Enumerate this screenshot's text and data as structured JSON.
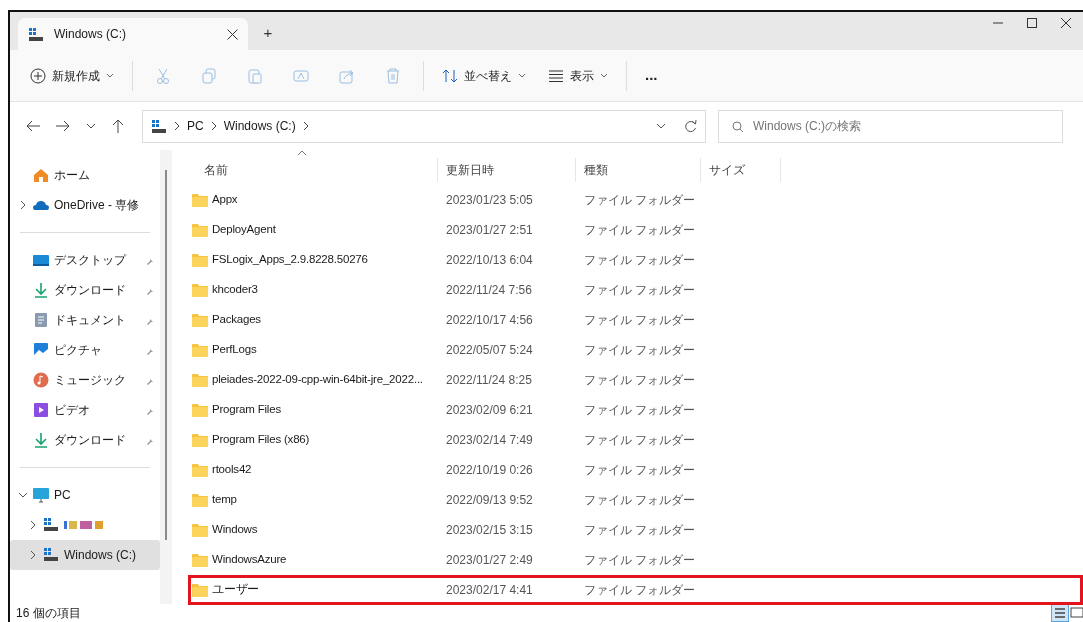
{
  "window": {
    "tab_title": "Windows (C:)",
    "new_tab": "+"
  },
  "toolbar": {
    "new": "新規作成",
    "sort": "並べ替え",
    "view": "表示",
    "more": "..."
  },
  "address": {
    "segments": [
      "PC",
      "Windows (C:)"
    ]
  },
  "search": {
    "placeholder": "Windows (C:)の検索"
  },
  "sidebar": {
    "items": [
      {
        "kind": "home",
        "label": "ホーム",
        "pinned": false,
        "expandable": false,
        "selected": false
      },
      {
        "kind": "cloud",
        "label": "OneDrive - 専修",
        "pinned": false,
        "expandable": true,
        "expanded": false,
        "selected": false
      },
      {
        "kind": "divider"
      },
      {
        "kind": "desktop",
        "label": "デスクトップ",
        "pinned": true,
        "expandable": false,
        "selected": false
      },
      {
        "kind": "download",
        "label": "ダウンロード",
        "pinned": true,
        "expandable": false,
        "selected": false
      },
      {
        "kind": "document",
        "label": "ドキュメント",
        "pinned": true,
        "expandable": false,
        "selected": false
      },
      {
        "kind": "picture",
        "label": "ピクチャ",
        "pinned": true,
        "expandable": false,
        "selected": false
      },
      {
        "kind": "music",
        "label": "ミュージック",
        "pinned": true,
        "expandable": false,
        "selected": false
      },
      {
        "kind": "video",
        "label": "ビデオ",
        "pinned": true,
        "expandable": false,
        "selected": false
      },
      {
        "kind": "download",
        "label": "ダウンロード",
        "pinned": true,
        "expandable": false,
        "selected": false
      },
      {
        "kind": "divider"
      },
      {
        "kind": "pc",
        "label": "PC",
        "pinned": false,
        "expandable": true,
        "expanded": true,
        "selected": false
      },
      {
        "kind": "drive",
        "pinned": false,
        "expandable": true,
        "expanded": false,
        "selected": false,
        "child": true
      },
      {
        "kind": "drive",
        "label": "Windows (C:)",
        "pinned": false,
        "expandable": true,
        "expanded": false,
        "selected": true,
        "child": true
      }
    ]
  },
  "table": {
    "columns": [
      "名前",
      "更新日時",
      "種類",
      "サイズ"
    ],
    "rows": [
      {
        "name": "Appx",
        "modified": "2023/01/23 5:05",
        "type": "ファイル フォルダー",
        "highlighted": false
      },
      {
        "name": "DeployAgent",
        "modified": "2023/01/27 2:51",
        "type": "ファイル フォルダー",
        "highlighted": false
      },
      {
        "name": "FSLogix_Apps_2.9.8228.50276",
        "modified": "2022/10/13 6:04",
        "type": "ファイル フォルダー",
        "highlighted": false
      },
      {
        "name": "khcoder3",
        "modified": "2022/11/24 7:56",
        "type": "ファイル フォルダー",
        "highlighted": false
      },
      {
        "name": "Packages",
        "modified": "2022/10/17 4:56",
        "type": "ファイル フォルダー",
        "highlighted": false
      },
      {
        "name": "PerfLogs",
        "modified": "2022/05/07 5:24",
        "type": "ファイル フォルダー",
        "highlighted": false
      },
      {
        "name": "pleiades-2022-09-cpp-win-64bit-jre_2022...",
        "modified": "2022/11/24 8:25",
        "type": "ファイル フォルダー",
        "highlighted": false
      },
      {
        "name": "Program Files",
        "modified": "2023/02/09 6:21",
        "type": "ファイル フォルダー",
        "highlighted": false
      },
      {
        "name": "Program Files (x86)",
        "modified": "2023/02/14 7:49",
        "type": "ファイル フォルダー",
        "highlighted": false
      },
      {
        "name": "rtools42",
        "modified": "2022/10/19 0:26",
        "type": "ファイル フォルダー",
        "highlighted": false
      },
      {
        "name": "temp",
        "modified": "2022/09/13 9:52",
        "type": "ファイル フォルダー",
        "highlighted": false
      },
      {
        "name": "Windows",
        "modified": "2023/02/15 3:15",
        "type": "ファイル フォルダー",
        "highlighted": false
      },
      {
        "name": "WindowsAzure",
        "modified": "2023/01/27 2:49",
        "type": "ファイル フォルダー",
        "highlighted": false
      },
      {
        "name": "ユーザー",
        "modified": "2023/02/17 4:41",
        "type": "ファイル フォルダー",
        "highlighted": true
      }
    ]
  },
  "status_bar": {
    "count": "16 個の項目",
    "details_view_selected": true
  }
}
